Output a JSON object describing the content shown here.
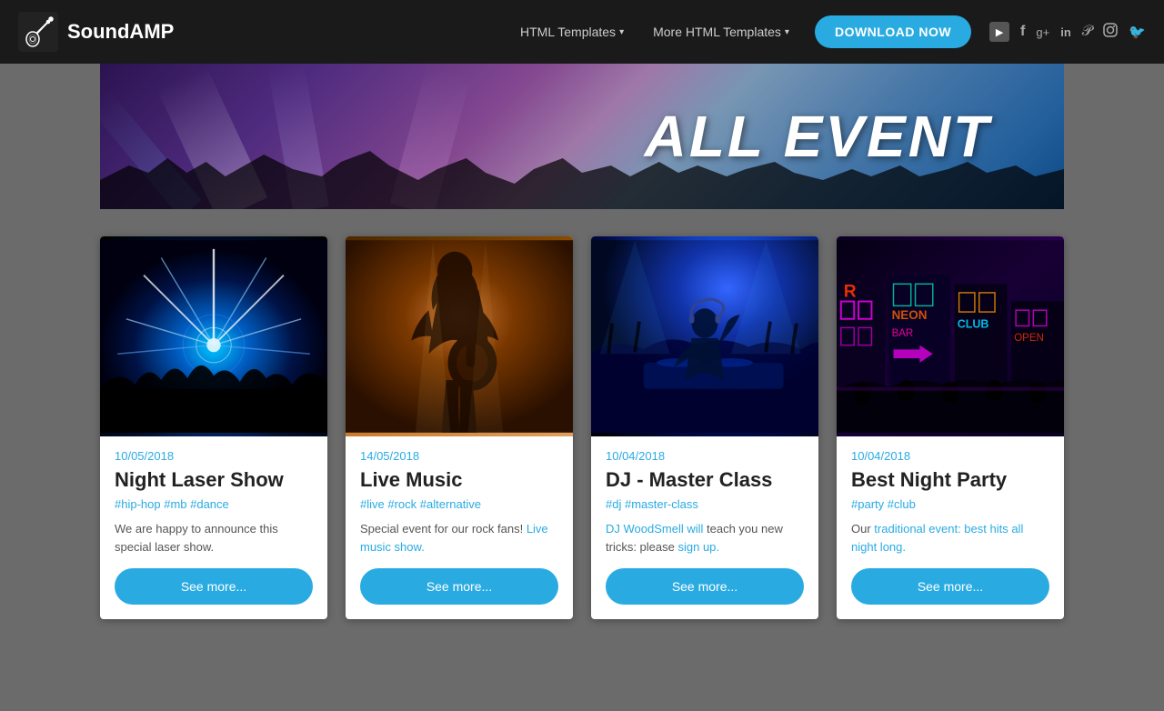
{
  "brand": {
    "name": "SoundAMP"
  },
  "nav": {
    "html_templates": "HTML Templates",
    "more_templates": "More HTML Templates",
    "download_button": "DOWNLOAD NOW"
  },
  "social": {
    "icons": [
      "youtube",
      "facebook",
      "google-plus",
      "linkedin",
      "pinterest",
      "instagram",
      "twitter"
    ]
  },
  "hero": {
    "title": "ALL EVENT"
  },
  "cards": [
    {
      "date": "10/05/2018",
      "title": "Night Laser Show",
      "tags": "#hip-hop #mb #dance",
      "description": "We are happy to announce this special laser show.",
      "button": "See more...",
      "theme": "laser"
    },
    {
      "date": "14/05/2018",
      "title": "Live Music",
      "tags": "#live #rock #alternative",
      "description": "Special event for our rock fans! Live music show.",
      "button": "See more...",
      "theme": "music"
    },
    {
      "date": "10/04/2018",
      "title": "DJ - Master Class",
      "tags": "#dj #master-class",
      "description": "DJ WoodSmell will teach you new tricks: please sign up.",
      "button": "See more...",
      "theme": "dj"
    },
    {
      "date": "10/04/2018",
      "title": "Best Night Party",
      "tags": "#party #club",
      "description": "Our traditional event: best hits all night long.",
      "button": "See more...",
      "theme": "party"
    }
  ]
}
